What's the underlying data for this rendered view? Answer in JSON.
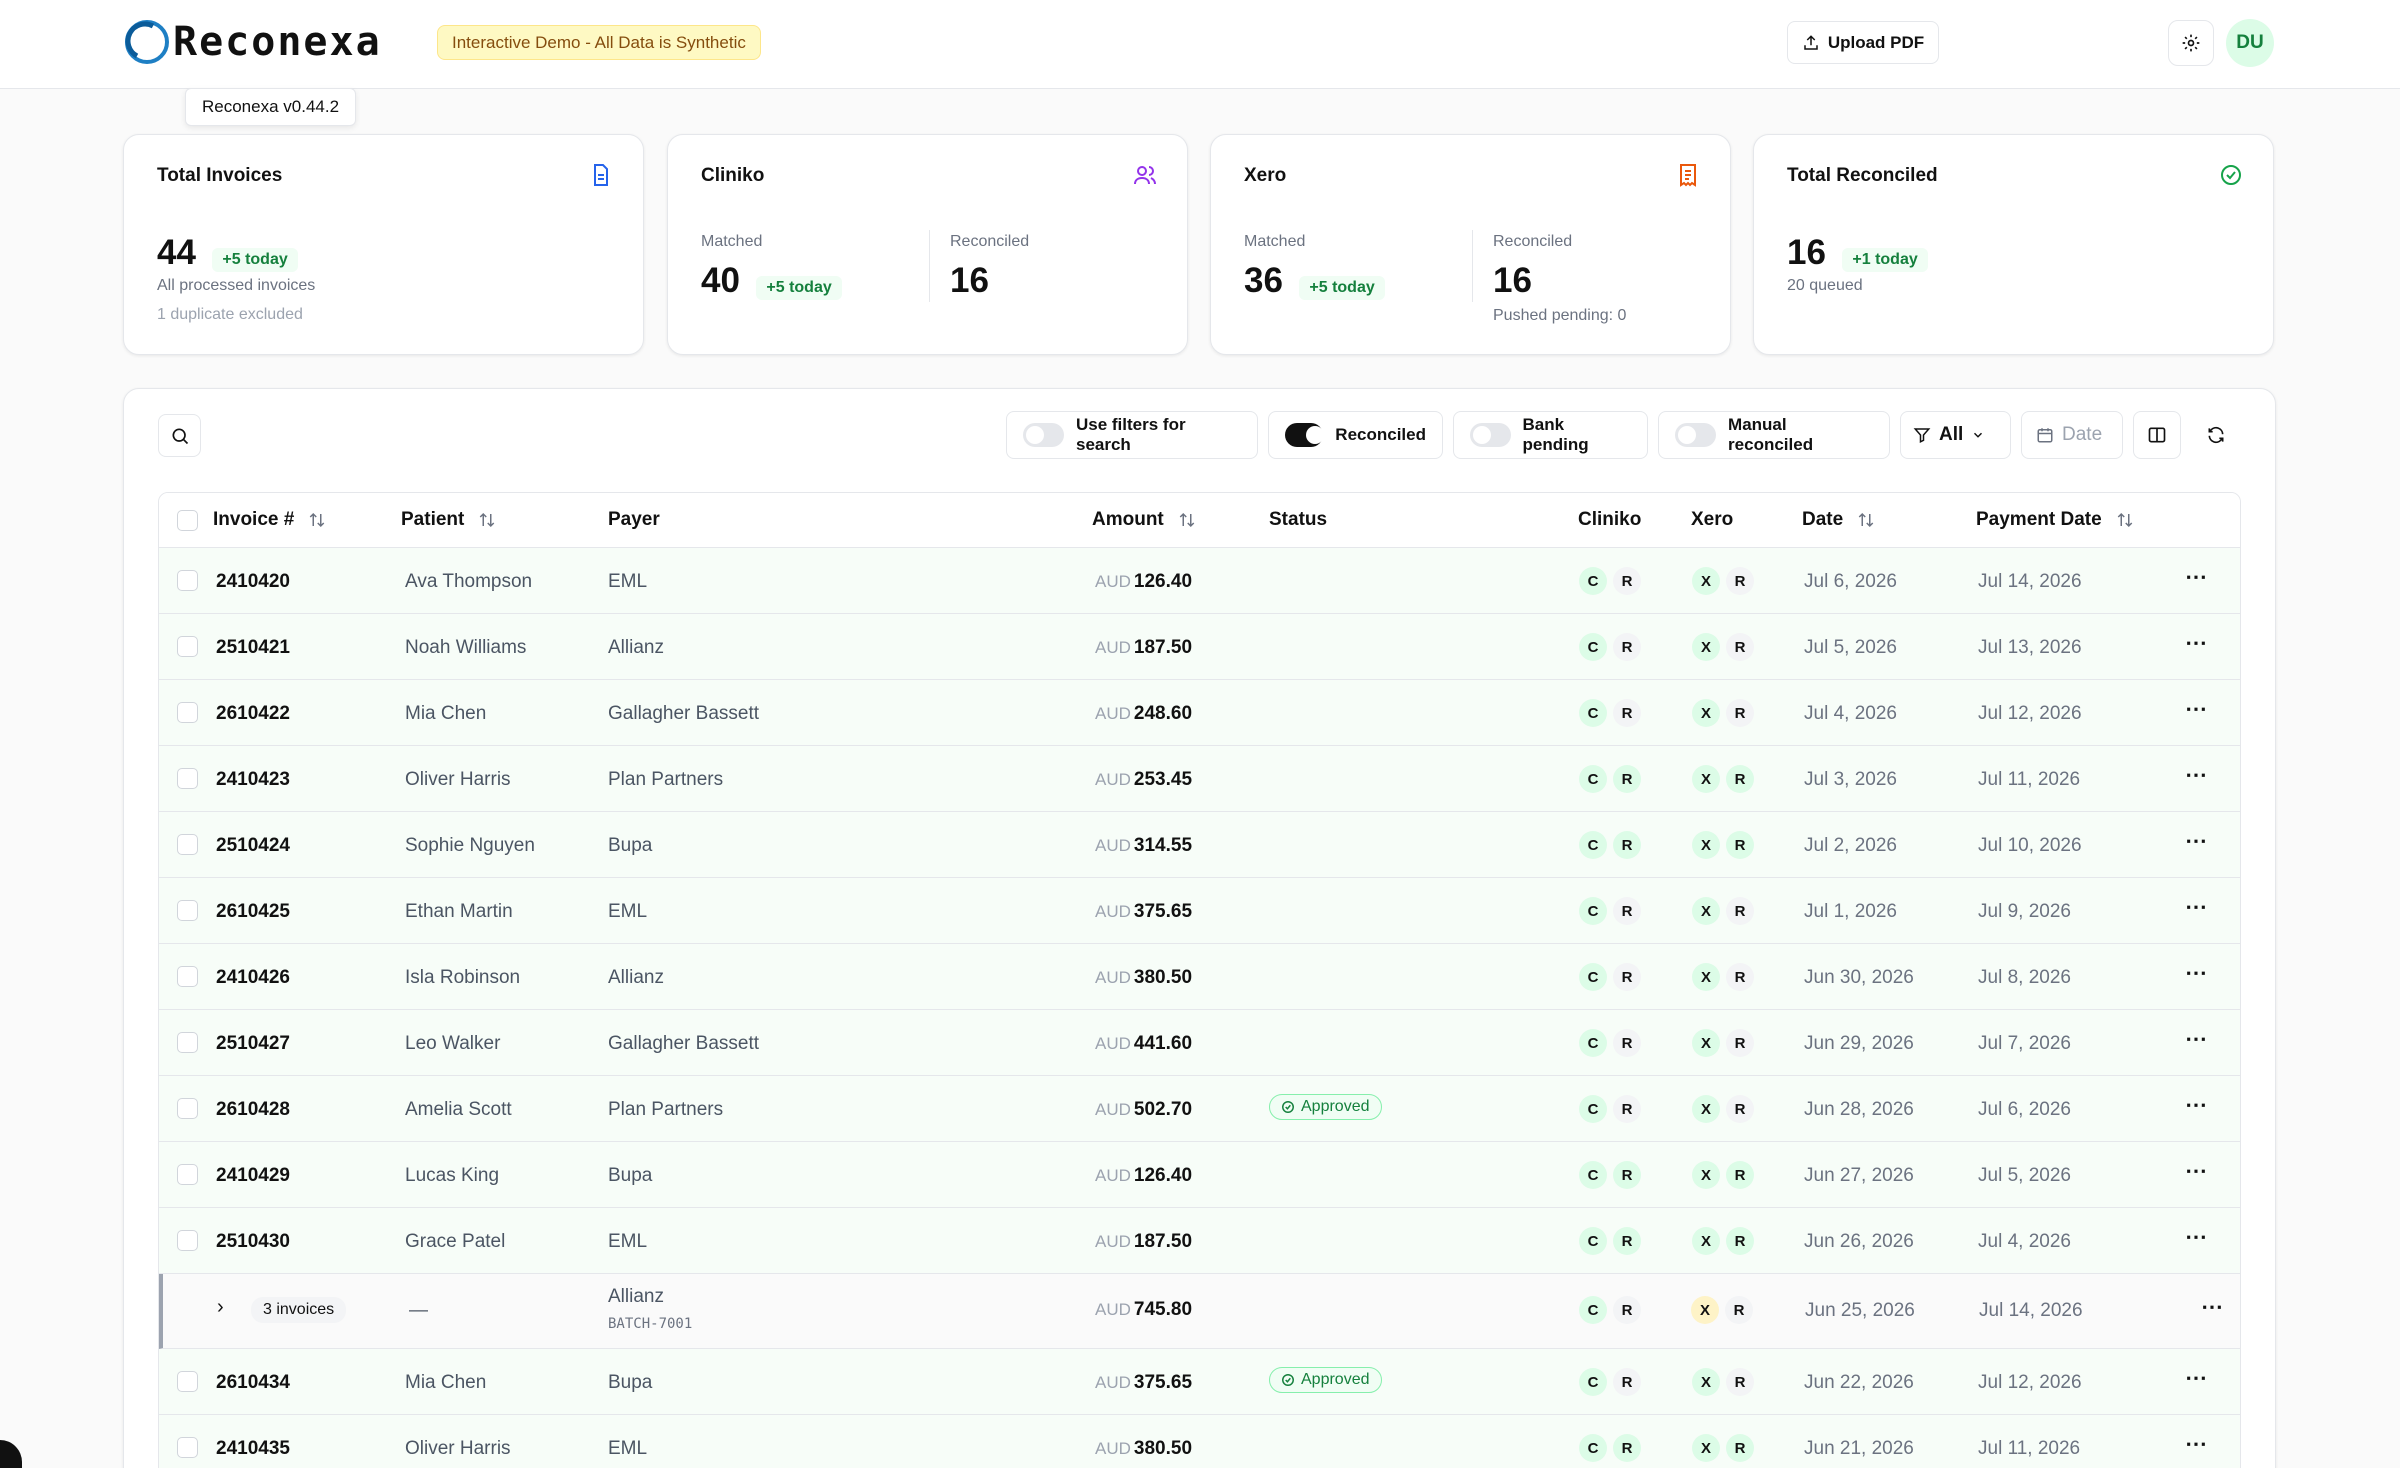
{
  "app": {
    "logo_text": "Reconexa",
    "demo_badge": "Interactive Demo - All Data is Synthetic",
    "upload_label": "Upload PDF",
    "avatar_initials": "DU",
    "version_tooltip": "Reconexa v0.44.2"
  },
  "cards": {
    "total": {
      "title": "Total Invoices",
      "value": "44",
      "delta": "+5 today",
      "line1": "All processed invoices",
      "line2": "1 duplicate excluded"
    },
    "cliniko": {
      "title": "Cliniko",
      "matched_label": "Matched",
      "matched": "40",
      "delta": "+5 today",
      "reconciled_label": "Reconciled",
      "reconciled": "16"
    },
    "xero": {
      "title": "Xero",
      "matched_label": "Matched",
      "matched": "36",
      "delta": "+5 today",
      "reconciled_label": "Reconciled",
      "reconciled": "16",
      "pending": "Pushed pending: 0"
    },
    "reconciled": {
      "title": "Total Reconciled",
      "value": "16",
      "delta": "+1 today",
      "line1": "20 queued"
    }
  },
  "toolbar": {
    "use_filters": "Use filters for search",
    "reconciled": "Reconciled",
    "bank_pending": "Bank pending",
    "manual_reconciled": "Manual reconciled",
    "filter_value": "All",
    "date_placeholder": "Date"
  },
  "table": {
    "headers": {
      "invoice": "Invoice #",
      "patient": "Patient",
      "payer": "Payer",
      "amount": "Amount",
      "status": "Status",
      "cliniko": "Cliniko",
      "xero": "Xero",
      "date": "Date",
      "payment_date": "Payment Date"
    },
    "rows": [
      {
        "invoice": "2410420",
        "patient": "Ava Thompson",
        "payer": "EML",
        "currency": "AUD",
        "amount": "126.40",
        "status": "",
        "cliniko": [
          "C",
          "R"
        ],
        "xero": [
          "X",
          "R"
        ],
        "date": "Jul 6, 2026",
        "payment_date": "Jul 14, 2026"
      },
      {
        "invoice": "2510421",
        "patient": "Noah Williams",
        "payer": "Allianz",
        "currency": "AUD",
        "amount": "187.50",
        "status": "",
        "cliniko": [
          "C",
          "R"
        ],
        "xero": [
          "X",
          "R"
        ],
        "date": "Jul 5, 2026",
        "payment_date": "Jul 13, 2026"
      },
      {
        "invoice": "2610422",
        "patient": "Mia Chen",
        "payer": "Gallagher Bassett",
        "currency": "AUD",
        "amount": "248.60",
        "status": "",
        "cliniko": [
          "C",
          "R"
        ],
        "xero": [
          "X",
          "R"
        ],
        "date": "Jul 4, 2026",
        "payment_date": "Jul 12, 2026"
      },
      {
        "invoice": "2410423",
        "patient": "Oliver Harris",
        "payer": "Plan Partners",
        "currency": "AUD",
        "amount": "253.45",
        "status": "",
        "cliniko": [
          "C",
          "R"
        ],
        "xero": [
          "X",
          "R"
        ],
        "date": "Jul 3, 2026",
        "payment_date": "Jul 11, 2026"
      },
      {
        "invoice": "2510424",
        "patient": "Sophie Nguyen",
        "payer": "Bupa",
        "currency": "AUD",
        "amount": "314.55",
        "status": "",
        "cliniko": [
          "C",
          "R"
        ],
        "xero": [
          "X",
          "R"
        ],
        "date": "Jul 2, 2026",
        "payment_date": "Jul 10, 2026"
      },
      {
        "invoice": "2610425",
        "patient": "Ethan Martin",
        "payer": "EML",
        "currency": "AUD",
        "amount": "375.65",
        "status": "",
        "cliniko": [
          "C",
          "R"
        ],
        "xero": [
          "X",
          "R"
        ],
        "date": "Jul 1, 2026",
        "payment_date": "Jul 9, 2026"
      },
      {
        "invoice": "2410426",
        "patient": "Isla Robinson",
        "payer": "Allianz",
        "currency": "AUD",
        "amount": "380.50",
        "status": "",
        "cliniko": [
          "C",
          "R"
        ],
        "xero": [
          "X",
          "R"
        ],
        "date": "Jun 30, 2026",
        "payment_date": "Jul 8, 2026"
      },
      {
        "invoice": "2510427",
        "patient": "Leo Walker",
        "payer": "Gallagher Bassett",
        "currency": "AUD",
        "amount": "441.60",
        "status": "",
        "cliniko": [
          "C",
          "R"
        ],
        "xero": [
          "X",
          "R"
        ],
        "date": "Jun 29, 2026",
        "payment_date": "Jul 7, 2026"
      },
      {
        "invoice": "2610428",
        "patient": "Amelia Scott",
        "payer": "Plan Partners",
        "currency": "AUD",
        "amount": "502.70",
        "status": "Approved",
        "cliniko": [
          "C",
          "R"
        ],
        "xero": [
          "X",
          "R"
        ],
        "date": "Jun 28, 2026",
        "payment_date": "Jul 6, 2026"
      },
      {
        "invoice": "2410429",
        "patient": "Lucas King",
        "payer": "Bupa",
        "currency": "AUD",
        "amount": "126.40",
        "status": "",
        "cliniko": [
          "C",
          "R"
        ],
        "xero": [
          "X",
          "R"
        ],
        "date": "Jun 27, 2026",
        "payment_date": "Jul 5, 2026"
      },
      {
        "invoice": "2510430",
        "patient": "Grace Patel",
        "payer": "EML",
        "currency": "AUD",
        "amount": "187.50",
        "status": "",
        "cliniko": [
          "C",
          "R"
        ],
        "xero": [
          "X",
          "R"
        ],
        "date": "Jun 26, 2026",
        "payment_date": "Jul 4, 2026"
      }
    ],
    "group": {
      "count_label": "3 invoices",
      "patient": "—",
      "payer": "Allianz",
      "batch": "BATCH-7001",
      "currency": "AUD",
      "amount": "745.80",
      "cliniko": [
        "C",
        "R"
      ],
      "xero": [
        "X",
        "R"
      ],
      "date": "Jun 25, 2026",
      "payment_date": "Jul 14, 2026"
    },
    "rows_after": [
      {
        "invoice": "2610434",
        "patient": "Mia Chen",
        "payer": "Bupa",
        "currency": "AUD",
        "amount": "375.65",
        "status": "Approved",
        "cliniko": [
          "C",
          "R"
        ],
        "xero": [
          "X",
          "R"
        ],
        "date": "Jun 22, 2026",
        "payment_date": "Jul 12, 2026"
      },
      {
        "invoice": "2410435",
        "patient": "Oliver Harris",
        "payer": "EML",
        "currency": "AUD",
        "amount": "380.50",
        "status": "",
        "cliniko": [
          "C",
          "R"
        ],
        "xero": [
          "X",
          "R"
        ],
        "date": "Jun 21, 2026",
        "payment_date": "Jul 11, 2026"
      }
    ]
  },
  "colors": {
    "brand": "#1e7fc4",
    "success": "#15803d",
    "warning": "#fef3c7"
  }
}
